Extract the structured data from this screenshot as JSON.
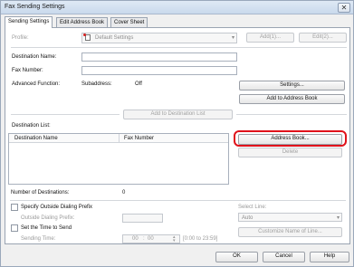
{
  "window": {
    "title": "Fax Sending Settings",
    "close_glyph": "✕"
  },
  "tabs": [
    {
      "label": "Sending Settings",
      "active": true
    },
    {
      "label": "Edit Address Book",
      "active": false
    },
    {
      "label": "Cover Sheet",
      "active": false
    }
  ],
  "profile": {
    "label": "Profile:",
    "value": "Default Settings",
    "add_label": "Add(1)...",
    "edit_label": "Edit(2)..."
  },
  "destination": {
    "name_label": "Destination Name:",
    "fax_label": "Fax Number:",
    "advanced_label": "Advanced Function:",
    "subaddress_label": "Subaddress:",
    "subaddress_value": "Off",
    "settings_label": "Settings...",
    "add_to_book_label": "Add to Address Book",
    "add_to_list_label": "Add to Destination List"
  },
  "dest_list": {
    "label": "Destination List:",
    "columns": [
      "Destination Name",
      "Fax Number"
    ],
    "rows": [],
    "address_book_label": "Address Book...",
    "delete_label": "Delete",
    "count_label": "Number of Destinations:",
    "count_value": "0"
  },
  "outside": {
    "check_label": "Specify Outside Dialing Prefix",
    "prefix_label": "Outside Dialing Prefix:",
    "line_label": "Select Line:",
    "line_value": "Auto"
  },
  "timing": {
    "check_label": "Set the Time to Send",
    "time_label": "Sending Time:",
    "hour": "00",
    "minute": "00",
    "separator": ":",
    "range": "[0:00 to 23:59]",
    "customize_label": "Customize Name of Line..."
  },
  "footer": {
    "ok": "OK",
    "cancel": "Cancel",
    "help": "Help"
  }
}
